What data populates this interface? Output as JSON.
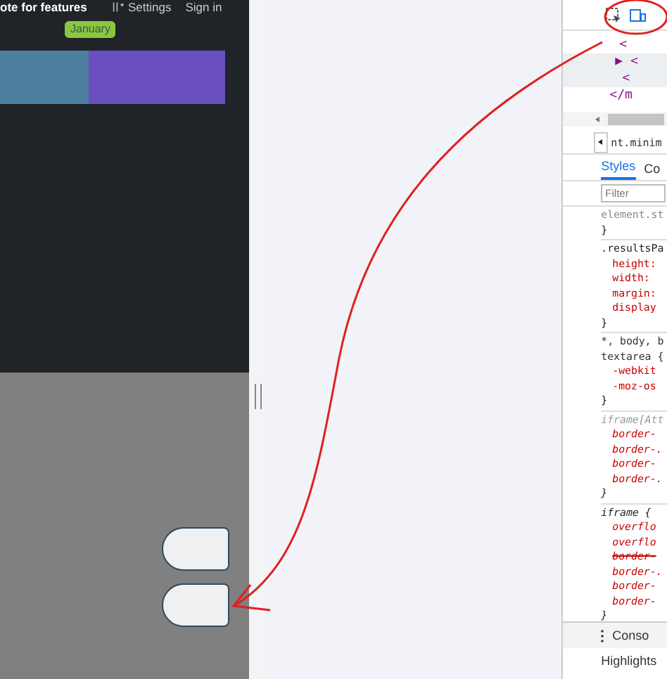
{
  "page": {
    "title_fragment": "ote for features",
    "settings": "Settings",
    "sign_in": "Sign in",
    "badge": "January"
  },
  "bar": [
    {
      "color": "#4f7fa0"
    },
    {
      "color": "#6a4fc0"
    }
  ],
  "devtools": {
    "dom_lines": [
      {
        "text": "<",
        "highlighted": false
      },
      {
        "text": "▶ <",
        "highlighted": true
      },
      {
        "text": "<",
        "highlighted": true
      },
      {
        "text": "</m",
        "highlighted": false
      }
    ],
    "breadcrumb": "nt.minim",
    "tabs": [
      {
        "label": "Styles",
        "selected": true
      },
      {
        "label": "Co",
        "selected": false
      }
    ],
    "filter": {
      "placeholder": "Filter"
    },
    "rules": [
      {
        "kind": "inline",
        "selector": "element.st",
        "close": "}"
      },
      {
        "kind": "normal",
        "selector": ".resultsPa",
        "props": [
          {
            "text": "height:",
            "struck": false
          },
          {
            "text": "width:",
            "struck": false
          },
          {
            "text": "margin:",
            "struck": false
          },
          {
            "text": "display",
            "struck": false
          }
        ],
        "close": "}"
      },
      {
        "kind": "agent",
        "selector": "*, body, b",
        "selector_2": "textarea {",
        "props": [
          {
            "text": "-webkit",
            "struck": false
          },
          {
            "text": "-moz-os",
            "struck": false
          }
        ],
        "close": "}"
      },
      {
        "kind": "agent-italic",
        "selector": "iframe[Att",
        "props": [
          {
            "text": "border-",
            "struck": false
          },
          {
            "text": "border-.",
            "struck": false
          },
          {
            "text": "border-",
            "struck": false
          },
          {
            "text": "border-.",
            "struck": false
          }
        ],
        "close": "}"
      },
      {
        "kind": "italic",
        "selector": "iframe {",
        "props": [
          {
            "text": "overflo",
            "struck": false
          },
          {
            "text": "overflo",
            "struck": false
          },
          {
            "text": "border-",
            "struck": true
          },
          {
            "text": "border-.",
            "struck": false
          },
          {
            "text": "border-",
            "struck": false
          },
          {
            "text": "border-",
            "struck": false
          }
        ],
        "close": "}"
      }
    ],
    "drawer_tab": "Conso",
    "bottom_tab": "Highlights"
  }
}
